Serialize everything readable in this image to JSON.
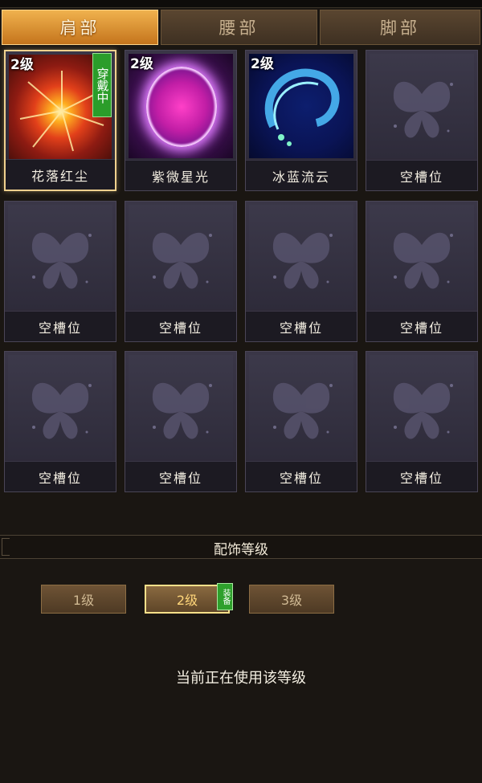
{
  "tabs": [
    {
      "label": "肩部",
      "active": true
    },
    {
      "label": "腰部",
      "active": false
    },
    {
      "label": "脚部",
      "active": false
    }
  ],
  "slots": [
    {
      "name": "花落红尘",
      "level": "2级",
      "art": "red-burst",
      "wearing": "穿戴中",
      "selected": true
    },
    {
      "name": "紫微星光",
      "level": "2级",
      "art": "purple-orb"
    },
    {
      "name": "冰蓝流云",
      "level": "2级",
      "art": "blue-swirl"
    },
    {
      "name": "空槽位",
      "art": "empty"
    },
    {
      "name": "空槽位",
      "art": "empty"
    },
    {
      "name": "空槽位",
      "art": "empty"
    },
    {
      "name": "空槽位",
      "art": "empty"
    },
    {
      "name": "空槽位",
      "art": "empty"
    },
    {
      "name": "空槽位",
      "art": "empty"
    },
    {
      "name": "空槽位",
      "art": "empty"
    },
    {
      "name": "空槽位",
      "art": "empty"
    },
    {
      "name": "空槽位",
      "art": "empty"
    }
  ],
  "section_title": "配饰等级",
  "levels": [
    {
      "label": "1级",
      "active": false
    },
    {
      "label": "2级",
      "active": true,
      "badge": "装备"
    },
    {
      "label": "3级",
      "active": false
    }
  ],
  "status_text": "当前正在使用该等级",
  "colors": {
    "active_tab": "#e8962e",
    "wearing_badge": "#2b9d2a",
    "selected_border": "#f0d18e",
    "slot_bg": "#2e2b3a"
  }
}
